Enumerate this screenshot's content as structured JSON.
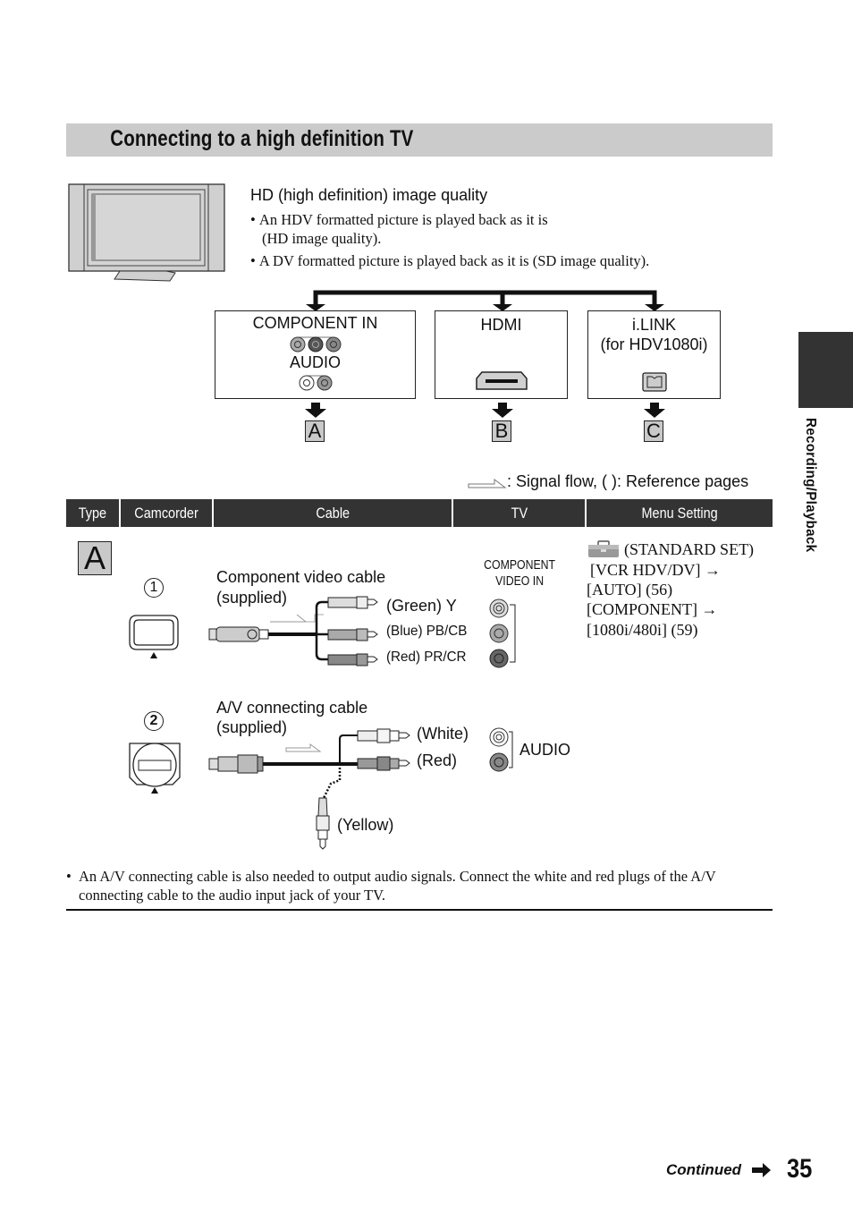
{
  "section": {
    "title": "Connecting to a high definition TV"
  },
  "intro": {
    "heading": "HD (high definition) image quality",
    "bullets": [
      {
        "line1": "An HDV formatted picture is played back as it is",
        "line2": "(HD image quality)."
      },
      {
        "line1": "A DV formatted picture is played back as it is (SD image quality)."
      }
    ]
  },
  "tv_ports": [
    {
      "label": "COMPONENT IN",
      "sub_label": "AUDIO",
      "letter": "A"
    },
    {
      "label": "HDMI",
      "letter": "B"
    },
    {
      "label": "i.LINK",
      "sub_label": "(for HDV1080i)",
      "letter": "C"
    }
  ],
  "legend": {
    "text": ": Signal flow, ( ): Reference pages",
    "icon": "signal-flow-arrow-icon"
  },
  "table": {
    "headers": [
      "Type",
      "Camcorder",
      "Cable",
      "TV",
      "Menu Setting"
    ],
    "type_letter": "A",
    "rows": [
      {
        "step": "1",
        "cable_name": "Component video cable",
        "cable_note": "(supplied)",
        "plugs": [
          "(Green) Y",
          "(Blue) PB/CB",
          "(Red) PR/CR"
        ],
        "tv_label_line1": "COMPONENT",
        "tv_label_line2": "VIDEO IN",
        "menu": {
          "icon": "toolbox-icon",
          "lines": [
            "(STANDARD SET)",
            "[VCR HDV/DV] →",
            "[AUTO] (56)",
            "[COMPONENT] →",
            "[1080i/480i] (59)"
          ]
        }
      },
      {
        "step": "2",
        "cable_name": "A/V connecting cable",
        "cable_note": "(supplied)",
        "plugs": [
          "(White)",
          "(Red)",
          "(Yellow)"
        ],
        "tv_label": "AUDIO"
      }
    ]
  },
  "note": "An A/V connecting cable is also needed to output audio signals. Connect the white and red plugs of the A/V connecting cable to the audio input jack of your TV.",
  "side_tab": {
    "label": "Recording/Playback"
  },
  "footer": {
    "continued": "Continued",
    "page_number": "35"
  }
}
